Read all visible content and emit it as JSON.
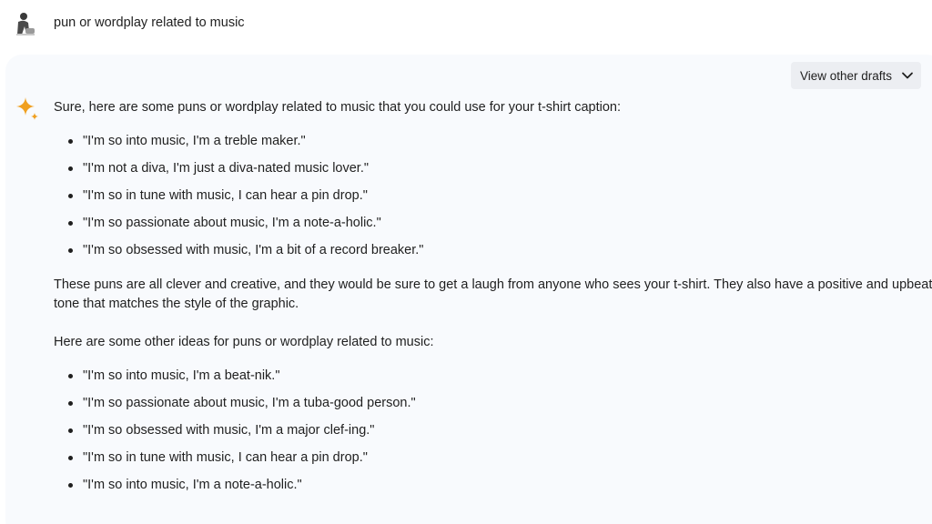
{
  "prompt": {
    "text": "pun or wordplay related to music"
  },
  "response": {
    "drafts_button_label": "View other drafts",
    "intro": "Sure, here are some puns or wordplay related to music that you could use for your t-shirt caption:",
    "list1": [
      "\"I'm so into music, I'm a treble maker.\"",
      "\"I'm not a diva, I'm just a diva-nated music lover.\"",
      "\"I'm so in tune with music, I can hear a pin drop.\"",
      "\"I'm so passionate about music, I'm a note-a-holic.\"",
      "\"I'm so obsessed with music, I'm a bit of a record breaker.\""
    ],
    "paragraph": "These puns are all clever and creative, and they would be sure to get a laugh from anyone who sees your t-shirt. They also have a positive and upbeat tone that matches the style of the graphic.",
    "other_ideas": "Here are some other ideas for puns or wordplay related to music:",
    "list2": [
      "\"I'm so into music, I'm a beat-nik.\"",
      "\"I'm so passionate about music, I'm a tuba-good person.\"",
      "\"I'm so obsessed with music, I'm a major clef-ing.\"",
      "\"I'm so in tune with music, I can hear a pin drop.\"",
      "\"I'm so into music, I'm a note-a-holic.\""
    ]
  },
  "icons": {
    "avatar": "user-avatar",
    "sparkle": "sparkle-icon",
    "chevron": "chevron-down-icon"
  },
  "colors": {
    "sparkle_orange": "#f0a020",
    "card_background": "#f8fafd",
    "button_background": "#eceef2"
  }
}
